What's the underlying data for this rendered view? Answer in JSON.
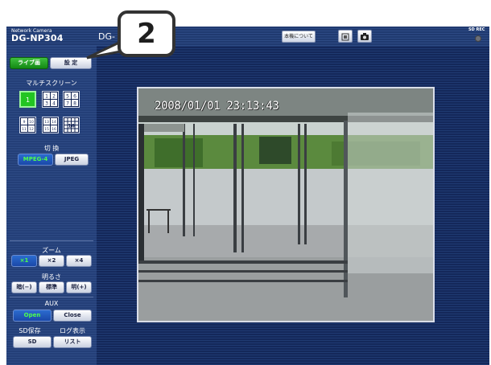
{
  "header": {
    "brand_small": "Network Camera",
    "model": "DG-NP304",
    "camera_title": "DG-",
    "about_label": "本機について",
    "snapshot_icon": "snapshot-icon",
    "camera_icon": "camera-icon",
    "sd_rec_label": "SD REC"
  },
  "sidebar": {
    "live_label": "ライブ画",
    "setup_label": "設 定",
    "multiscreen_label": "マルチスクリーン",
    "screen_buttons": [
      {
        "label": "1"
      },
      {
        "label": "1 2 3 4"
      },
      {
        "label": "5 6 7 8"
      },
      {
        "label": "9 10 11 12"
      },
      {
        "label": "13 14 15 16"
      },
      {
        "label": "1-16"
      }
    ],
    "switch_label": "切 換",
    "mpeg_label": "MPEG-4",
    "jpeg_label": "JPEG",
    "zoom_label": "ズーム",
    "zoom_x1": "×1",
    "zoom_x2": "×2",
    "zoom_x4": "×4",
    "brightness_label": "明るさ",
    "dark_label": "暗(−)",
    "normal_label": "標準",
    "bright_label": "明(+)",
    "aux_label": "AUX",
    "open_label": "Open",
    "close_label": "Close",
    "sd_save_label": "SD保存",
    "log_label": "ログ表示",
    "sd_button": "SD",
    "list_button": "リスト"
  },
  "video": {
    "timestamp": "2008/01/01 23:13:43"
  },
  "callout": {
    "number": "2"
  },
  "colors": {
    "active_green": "#22c522",
    "frame_blue": "#14285a"
  }
}
